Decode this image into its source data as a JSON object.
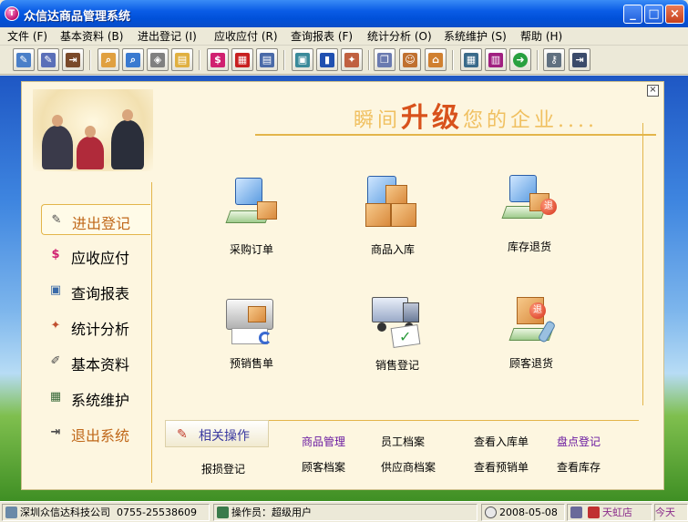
{
  "window": {
    "title": "众信达商品管理系统",
    "app_icon_letter": "T"
  },
  "menu": [
    {
      "label": "文件",
      "key": "(F)"
    },
    {
      "label": "基本资料",
      "key": "(B)"
    },
    {
      "label": "进出登记",
      "key": "(I)"
    },
    {
      "label": "应收应付",
      "key": "(R)"
    },
    {
      "label": "查询报表",
      "key": "(F)"
    },
    {
      "label": "统计分析",
      "key": "(O)"
    },
    {
      "label": "系统维护",
      "key": "(S)"
    },
    {
      "label": "帮助",
      "key": "(H)"
    }
  ],
  "toolbar_icons": [
    "edit-doc-icon",
    "edit-doc2-icon",
    "exit-doc-icon",
    "search-doc-icon",
    "magnify-icon",
    "tag-icon",
    "folder-icon",
    "dollar-icon",
    "report-red-icon",
    "report-icon",
    "preview-icon",
    "bar-chart-icon",
    "sticker-icon",
    "copy-icon",
    "users-icon",
    "home-icon",
    "calculator-icon",
    "books-icon",
    "go-green-icon",
    "key-icon",
    "logout-icon"
  ],
  "slogan": {
    "pre": "瞬间",
    "big": "升级",
    "post": "您的企业...."
  },
  "nav": [
    {
      "label": "进出登记",
      "icon": "edit-icon"
    },
    {
      "label": "应收应付",
      "icon": "dollar-icon"
    },
    {
      "label": "查询报表",
      "icon": "report-icon"
    },
    {
      "label": "统计分析",
      "icon": "analysis-icon"
    },
    {
      "label": "基本资料",
      "icon": "basic-data-icon"
    },
    {
      "label": "系统维护",
      "icon": "maintenance-icon"
    },
    {
      "label": "退出系统",
      "icon": "exit-icon"
    }
  ],
  "modules": [
    {
      "label": "采购订单",
      "icon": "purchase-order-icon"
    },
    {
      "label": "商品入库",
      "icon": "stock-in-icon"
    },
    {
      "label": "库存退货",
      "icon": "stock-return-icon"
    },
    {
      "label": "预销售单",
      "icon": "pre-sales-icon"
    },
    {
      "label": "销售登记",
      "icon": "sales-register-icon"
    },
    {
      "label": "顾客退货",
      "icon": "customer-return-icon"
    }
  ],
  "related": {
    "title": "相关操作",
    "links": [
      {
        "label": "商品管理"
      },
      {
        "label": "员工档案"
      },
      {
        "label": "查看入库单"
      },
      {
        "label": "盘点登记"
      },
      {
        "label": "报损登记"
      },
      {
        "label": "顾客档案"
      },
      {
        "label": "供应商档案"
      },
      {
        "label": "查看预销单"
      },
      {
        "label": "查看库存"
      }
    ]
  },
  "status": {
    "company": "深圳众信达科技公司",
    "phone": "0755-25538609",
    "operator_label": "操作员：超级用户",
    "date": "2008-05-08",
    "store": "天虹店",
    "extra": "今天"
  },
  "colors": {
    "panel_bg": "#fdf6e0",
    "accent_gold": "#e3b54a",
    "slogan_orange": "#d8521c",
    "link_purple": "#6a1aa0"
  }
}
